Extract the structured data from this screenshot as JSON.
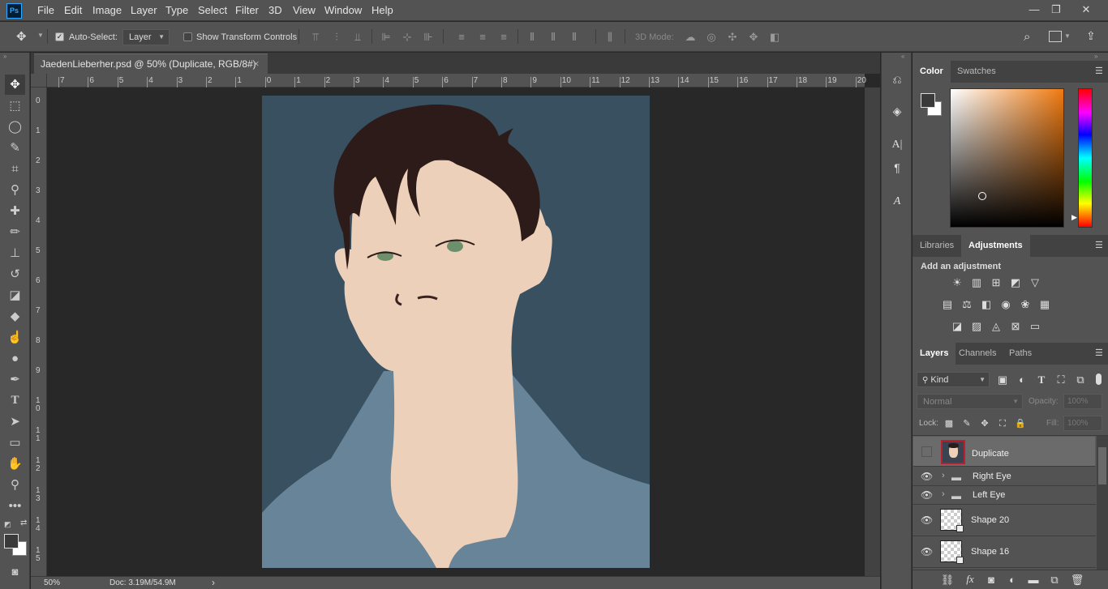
{
  "app": {
    "logo": "Ps"
  },
  "menu": [
    "File",
    "Edit",
    "Image",
    "Layer",
    "Type",
    "Select",
    "Filter",
    "3D",
    "View",
    "Window",
    "Help"
  ],
  "window_controls": {
    "minimize": "—",
    "restore": "❐",
    "close": "✕"
  },
  "options_bar": {
    "auto_select_label": "Auto-Select:",
    "auto_select_checked": true,
    "auto_select_target": "Layer",
    "show_transform_label": "Show Transform Controls",
    "mode_3d_label": "3D Mode:"
  },
  "document": {
    "tab_title": "JaedenLieberher.psd @ 50% (Duplicate, RGB/8#)",
    "tab_close": "×",
    "zoom": "50%",
    "doc_size": "Doc: 3.19M/54.9M",
    "status_arrow": "›"
  },
  "rulers": {
    "horizontal": [
      "7",
      "6",
      "5",
      "4",
      "3",
      "2",
      "1",
      "0",
      "1",
      "2",
      "3",
      "4",
      "5",
      "6",
      "7",
      "8",
      "9",
      "10",
      "11",
      "12",
      "13",
      "14",
      "15",
      "16",
      "17",
      "18",
      "19",
      "20"
    ],
    "vertical": [
      "0",
      "1",
      "2",
      "3",
      "4",
      "5",
      "6",
      "7",
      "8",
      "9",
      "1 0",
      "1 1",
      "1 2",
      "1 3",
      "1 4",
      "1 5"
    ]
  },
  "color_panel": {
    "tabs": [
      "Color",
      "Swatches"
    ],
    "active_tab": "Color",
    "foreground": "#3a3a3a",
    "background": "#ffffff",
    "picked_hue": "#f07a10"
  },
  "adjustments_panel": {
    "tabs": [
      "Libraries",
      "Adjustments"
    ],
    "active_tab": "Adjustments",
    "heading": "Add an adjustment",
    "icons": [
      [
        "brightness-icon",
        "levels-icon",
        "curves-icon",
        "exposure-icon",
        "vibrance-icon"
      ],
      [
        "hsl-icon",
        "color-balance-icon",
        "black-white-icon",
        "photo-filter-icon",
        "channel-mixer-icon",
        "color-lookup-icon"
      ],
      [
        "invert-icon",
        "posterize-icon",
        "threshold-icon",
        "selective-color-icon",
        "gradient-map-icon"
      ]
    ]
  },
  "layers_panel": {
    "tabs": [
      "Layers",
      "Channels",
      "Paths"
    ],
    "active_tab": "Layers",
    "filter_kind": "Kind",
    "blend_mode": "Normal",
    "opacity_label": "Opacity:",
    "opacity_value": "100%",
    "lock_label": "Lock:",
    "fill_label": "Fill:",
    "fill_value": "100%",
    "layers": [
      {
        "name": "Duplicate",
        "visible": false,
        "type": "image",
        "selected": true
      },
      {
        "name": "Right Eye",
        "visible": true,
        "type": "group",
        "selected": false
      },
      {
        "name": "Left Eye",
        "visible": true,
        "type": "group",
        "selected": false
      },
      {
        "name": "Shape 20",
        "visible": true,
        "type": "shape",
        "selected": false
      },
      {
        "name": "Shape 16",
        "visible": true,
        "type": "shape",
        "selected": false
      }
    ],
    "footer_fx": "fx"
  },
  "artwork_colors": {
    "background": "#385060",
    "shirt": "#678499",
    "skin": "#ecd0b9",
    "hair": "#2d1b1a",
    "iris": "#6e8f6c"
  }
}
